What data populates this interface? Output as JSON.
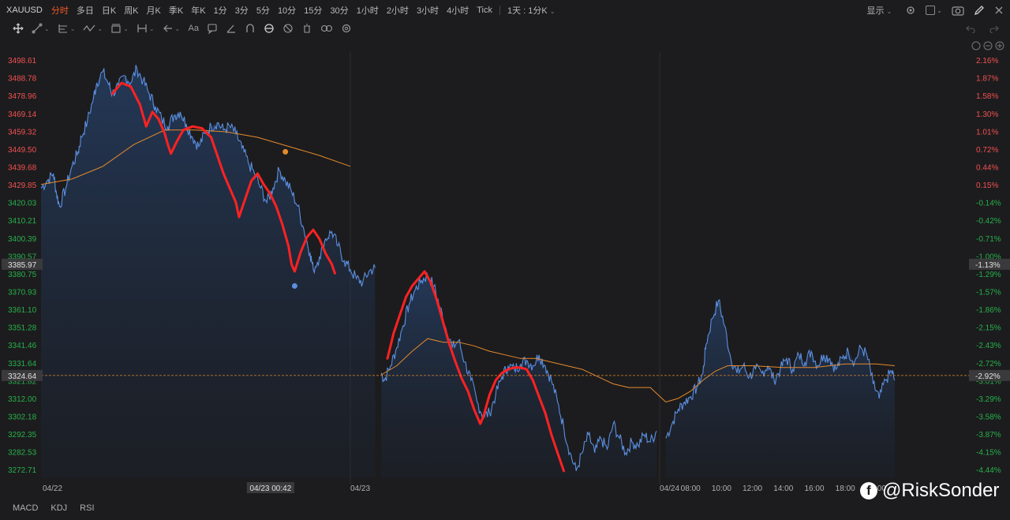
{
  "header": {
    "symbol": "XAUUSD",
    "timeframes": [
      {
        "label": "分时",
        "active": true
      },
      {
        "label": "多日",
        "active": false
      },
      {
        "label": "日K",
        "active": false
      },
      {
        "label": "周K",
        "active": false
      },
      {
        "label": "月K",
        "active": false
      },
      {
        "label": "季K",
        "active": false
      },
      {
        "label": "年K",
        "active": false
      },
      {
        "label": "1分",
        "active": false
      },
      {
        "label": "3分",
        "active": false
      },
      {
        "label": "5分",
        "active": false
      },
      {
        "label": "10分",
        "active": false
      },
      {
        "label": "15分",
        "active": false
      },
      {
        "label": "30分",
        "active": false
      },
      {
        "label": "1小时",
        "active": false
      },
      {
        "label": "2小时",
        "active": false
      },
      {
        "label": "3小时",
        "active": false
      },
      {
        "label": "4小时",
        "active": false
      },
      {
        "label": "Tick",
        "active": false
      }
    ],
    "period_select": "1天 : 1分K",
    "display_label": "显示"
  },
  "toolbar": {
    "tools": [
      "crosshair-icon",
      "line-tool-icon",
      "fib-tool-icon",
      "pattern-tool-icon",
      "shape-tool-icon",
      "measure-tool-icon",
      "arrow-tool-icon",
      "text-tool-icon",
      "note-tool-icon",
      "pen-tool-icon",
      "magnet-icon",
      "lock-icon",
      "hide-icon",
      "trash-icon",
      "link-icon",
      "settings-icon"
    ],
    "text_tool_label": "Aa"
  },
  "indicators": [
    "MACD",
    "KDJ",
    "RSI"
  ],
  "watermark": "@RiskSonder",
  "colors": {
    "price_line": "#5b8fe0",
    "ma_line": "#e58a2c",
    "annotation": "#ff2222",
    "up_label": "#f25050",
    "down_label": "#27b04a",
    "current_line": "#e58a2c"
  },
  "chart_data": {
    "type": "line",
    "symbol": "XAUUSD",
    "ylim": [
      3268,
      3503
    ],
    "prev_close": 3424.36,
    "price_ticks": [
      {
        "v": 3498.61,
        "pct": "2.16%"
      },
      {
        "v": 3488.78,
        "pct": "1.87%"
      },
      {
        "v": 3478.96,
        "pct": "1.58%"
      },
      {
        "v": 3469.14,
        "pct": "1.30%"
      },
      {
        "v": 3459.32,
        "pct": "1.01%"
      },
      {
        "v": 3449.5,
        "pct": "0.72%"
      },
      {
        "v": 3439.68,
        "pct": "0.44%"
      },
      {
        "v": 3429.85,
        "pct": "0.15%"
      },
      {
        "v": 3420.03,
        "pct": "-0.14%"
      },
      {
        "v": 3410.21,
        "pct": "-0.42%"
      },
      {
        "v": 3400.39,
        "pct": "-0.71%"
      },
      {
        "v": 3390.57,
        "pct": "-1.00%"
      },
      {
        "v": 3380.75,
        "pct": "-1.29%"
      },
      {
        "v": 3370.93,
        "pct": "-1.57%"
      },
      {
        "v": 3361.1,
        "pct": "-1.86%"
      },
      {
        "v": 3351.28,
        "pct": "-2.15%"
      },
      {
        "v": 3341.46,
        "pct": "-2.43%"
      },
      {
        "v": 3331.64,
        "pct": "-2.72%"
      },
      {
        "v": 3321.82,
        "pct": "-3.01%"
      },
      {
        "v": 3312.0,
        "pct": "-3.29%"
      },
      {
        "v": 3302.18,
        "pct": "-3.58%"
      },
      {
        "v": 3292.35,
        "pct": "-3.87%"
      },
      {
        "v": 3282.53,
        "pct": "-4.15%"
      },
      {
        "v": 3272.71,
        "pct": "-4.44%"
      }
    ],
    "crosshair": {
      "price": "3385.97",
      "pct": "-1.13%",
      "value": 3385.97
    },
    "current": {
      "price": "3324.64",
      "pct": "-2.92%",
      "value": 3324.64
    },
    "time_labels": [
      {
        "t": 0.0,
        "label": "04/22"
      },
      {
        "t": 0.742,
        "label": "04/23 00:42"
      },
      {
        "t": 1.0,
        "label": "04/23"
      },
      {
        "t": 2.0,
        "label": "04/24"
      },
      {
        "t": 2.1,
        "label": "08:00"
      },
      {
        "t": 2.2,
        "label": "10:00"
      },
      {
        "t": 2.3,
        "label": "12:00"
      },
      {
        "t": 2.4,
        "label": "14:00"
      },
      {
        "t": 2.5,
        "label": "16:00"
      },
      {
        "t": 2.6,
        "label": "18:00"
      },
      {
        "t": 2.7,
        "label": "20:00"
      }
    ],
    "day_breaks": [
      1.0,
      2.0
    ],
    "price_series": [
      [
        0.0,
        3428
      ],
      [
        0.02,
        3432
      ],
      [
        0.04,
        3436
      ],
      [
        0.05,
        3425
      ],
      [
        0.06,
        3418
      ],
      [
        0.08,
        3428
      ],
      [
        0.1,
        3440
      ],
      [
        0.12,
        3448
      ],
      [
        0.13,
        3456
      ],
      [
        0.15,
        3465
      ],
      [
        0.17,
        3478
      ],
      [
        0.18,
        3486
      ],
      [
        0.2,
        3492
      ],
      [
        0.22,
        3485
      ],
      [
        0.23,
        3480
      ],
      [
        0.25,
        3484
      ],
      [
        0.27,
        3490
      ],
      [
        0.29,
        3486
      ],
      [
        0.31,
        3494
      ],
      [
        0.33,
        3487
      ],
      [
        0.35,
        3480
      ],
      [
        0.37,
        3473
      ],
      [
        0.39,
        3466
      ],
      [
        0.41,
        3462
      ],
      [
        0.43,
        3468
      ],
      [
        0.45,
        3470
      ],
      [
        0.47,
        3463
      ],
      [
        0.49,
        3456
      ],
      [
        0.51,
        3451
      ],
      [
        0.53,
        3458
      ],
      [
        0.55,
        3462
      ],
      [
        0.57,
        3464
      ],
      [
        0.59,
        3460
      ],
      [
        0.61,
        3462
      ],
      [
        0.63,
        3458
      ],
      [
        0.65,
        3450
      ],
      [
        0.67,
        3442
      ],
      [
        0.69,
        3436
      ],
      [
        0.71,
        3428
      ],
      [
        0.73,
        3420
      ],
      [
        0.75,
        3428
      ],
      [
        0.77,
        3438
      ],
      [
        0.79,
        3432
      ],
      [
        0.81,
        3426
      ],
      [
        0.83,
        3418
      ],
      [
        0.85,
        3405
      ],
      [
        0.87,
        3392
      ],
      [
        0.88,
        3383
      ],
      [
        0.9,
        3390
      ],
      [
        0.92,
        3400
      ],
      [
        0.94,
        3404
      ],
      [
        0.96,
        3396
      ],
      [
        0.98,
        3388
      ],
      [
        1.0,
        3383
      ],
      [
        1.02,
        3378
      ],
      [
        1.04,
        3376
      ],
      [
        1.06,
        3382
      ],
      [
        1.08,
        3384
      ],
      [
        1.1,
        3326
      ],
      [
        1.11,
        3322
      ],
      [
        1.13,
        3330
      ],
      [
        1.15,
        3340
      ],
      [
        1.17,
        3352
      ],
      [
        1.19,
        3364
      ],
      [
        1.21,
        3372
      ],
      [
        1.23,
        3377
      ],
      [
        1.25,
        3380
      ],
      [
        1.27,
        3374
      ],
      [
        1.29,
        3362
      ],
      [
        1.31,
        3350
      ],
      [
        1.33,
        3340
      ],
      [
        1.35,
        3344
      ],
      [
        1.37,
        3332
      ],
      [
        1.39,
        3322
      ],
      [
        1.41,
        3310
      ],
      [
        1.43,
        3302
      ],
      [
        1.45,
        3304
      ],
      [
        1.47,
        3314
      ],
      [
        1.49,
        3324
      ],
      [
        1.51,
        3330
      ],
      [
        1.53,
        3328
      ],
      [
        1.55,
        3331
      ],
      [
        1.57,
        3333
      ],
      [
        1.59,
        3330
      ],
      [
        1.61,
        3336
      ],
      [
        1.63,
        3330
      ],
      [
        1.65,
        3322
      ],
      [
        1.67,
        3310
      ],
      [
        1.69,
        3296
      ],
      [
        1.71,
        3282
      ],
      [
        1.73,
        3272
      ],
      [
        1.75,
        3282
      ],
      [
        1.77,
        3292
      ],
      [
        1.79,
        3282
      ],
      [
        1.81,
        3290
      ],
      [
        1.83,
        3284
      ],
      [
        1.85,
        3298
      ],
      [
        1.87,
        3290
      ],
      [
        1.89,
        3282
      ],
      [
        1.91,
        3288
      ],
      [
        1.93,
        3286
      ],
      [
        1.95,
        3292
      ],
      [
        1.97,
        3288
      ],
      [
        1.99,
        3294
      ],
      [
        2.02,
        3290
      ],
      [
        2.04,
        3298
      ],
      [
        2.06,
        3306
      ],
      [
        2.08,
        3310
      ],
      [
        2.1,
        3313
      ],
      [
        2.12,
        3318
      ],
      [
        2.14,
        3326
      ],
      [
        2.15,
        3342
      ],
      [
        2.17,
        3356
      ],
      [
        2.19,
        3366
      ],
      [
        2.21,
        3352
      ],
      [
        2.23,
        3334
      ],
      [
        2.25,
        3326
      ],
      [
        2.27,
        3330
      ],
      [
        2.29,
        3324
      ],
      [
        2.31,
        3328
      ],
      [
        2.33,
        3326
      ],
      [
        2.35,
        3330
      ],
      [
        2.37,
        3322
      ],
      [
        2.39,
        3328
      ],
      [
        2.41,
        3334
      ],
      [
        2.43,
        3328
      ],
      [
        2.45,
        3336
      ],
      [
        2.47,
        3332
      ],
      [
        2.49,
        3338
      ],
      [
        2.51,
        3330
      ],
      [
        2.53,
        3336
      ],
      [
        2.55,
        3334
      ],
      [
        2.57,
        3328
      ],
      [
        2.59,
        3334
      ],
      [
        2.61,
        3338
      ],
      [
        2.63,
        3332
      ],
      [
        2.65,
        3340
      ],
      [
        2.67,
        3336
      ],
      [
        2.69,
        3320
      ],
      [
        2.71,
        3312
      ],
      [
        2.73,
        3322
      ],
      [
        2.75,
        3327
      ],
      [
        2.76,
        3322
      ]
    ],
    "ma_series": [
      [
        0.0,
        3430
      ],
      [
        0.1,
        3433
      ],
      [
        0.2,
        3440
      ],
      [
        0.3,
        3452
      ],
      [
        0.4,
        3460
      ],
      [
        0.5,
        3460
      ],
      [
        0.6,
        3459
      ],
      [
        0.7,
        3456
      ],
      [
        0.8,
        3451
      ],
      [
        0.9,
        3446
      ],
      [
        1.0,
        3440
      ],
      [
        1.1,
        3325
      ],
      [
        1.15,
        3330
      ],
      [
        1.2,
        3338
      ],
      [
        1.25,
        3345
      ],
      [
        1.3,
        3343
      ],
      [
        1.35,
        3343
      ],
      [
        1.4,
        3341
      ],
      [
        1.45,
        3338
      ],
      [
        1.5,
        3336
      ],
      [
        1.55,
        3334
      ],
      [
        1.6,
        3334
      ],
      [
        1.65,
        3332
      ],
      [
        1.7,
        3330
      ],
      [
        1.75,
        3328
      ],
      [
        1.8,
        3324
      ],
      [
        1.85,
        3320
      ],
      [
        1.9,
        3318
      ],
      [
        1.97,
        3318
      ],
      [
        2.02,
        3310
      ],
      [
        2.06,
        3312
      ],
      [
        2.1,
        3316
      ],
      [
        2.14,
        3322
      ],
      [
        2.18,
        3327
      ],
      [
        2.22,
        3330
      ],
      [
        2.3,
        3330
      ],
      [
        2.4,
        3329
      ],
      [
        2.5,
        3329
      ],
      [
        2.6,
        3331
      ],
      [
        2.7,
        3331
      ],
      [
        2.76,
        3330
      ]
    ],
    "annotation_path": [
      [
        0.23,
        3480
      ],
      [
        0.26,
        3486
      ],
      [
        0.29,
        3484
      ],
      [
        0.32,
        3474
      ],
      [
        0.34,
        3462
      ],
      [
        0.36,
        3470
      ],
      [
        0.38,
        3466
      ],
      [
        0.4,
        3458
      ],
      [
        0.41,
        3452
      ],
      [
        0.42,
        3447
      ],
      [
        0.44,
        3454
      ],
      [
        0.46,
        3460
      ],
      [
        0.49,
        3462
      ],
      [
        0.52,
        3461
      ],
      [
        0.55,
        3456
      ],
      [
        0.57,
        3446
      ],
      [
        0.59,
        3436
      ],
      [
        0.61,
        3428
      ],
      [
        0.63,
        3420
      ],
      [
        0.64,
        3412
      ],
      [
        0.66,
        3422
      ],
      [
        0.68,
        3432
      ],
      [
        0.7,
        3436
      ],
      [
        0.72,
        3430
      ],
      [
        0.74,
        3425
      ],
      [
        0.76,
        3418
      ],
      [
        0.78,
        3408
      ],
      [
        0.8,
        3396
      ],
      [
        0.81,
        3386
      ],
      [
        0.82,
        3382
      ],
      [
        0.84,
        3393
      ],
      [
        0.86,
        3401
      ],
      [
        0.88,
        3405
      ],
      [
        0.9,
        3400
      ],
      [
        0.92,
        3392
      ],
      [
        0.94,
        3386
      ],
      [
        0.95,
        3381
      ]
    ],
    "annotation_path_2": [
      [
        1.12,
        3334
      ],
      [
        1.14,
        3348
      ],
      [
        1.16,
        3358
      ],
      [
        1.18,
        3368
      ],
      [
        1.2,
        3374
      ],
      [
        1.22,
        3378
      ],
      [
        1.24,
        3382
      ],
      [
        1.26,
        3376
      ],
      [
        1.28,
        3366
      ],
      [
        1.3,
        3354
      ],
      [
        1.32,
        3342
      ],
      [
        1.34,
        3332
      ],
      [
        1.36,
        3323
      ],
      [
        1.38,
        3316
      ],
      [
        1.4,
        3306
      ],
      [
        1.42,
        3298
      ],
      [
        1.43,
        3302
      ],
      [
        1.45,
        3314
      ],
      [
        1.47,
        3322
      ],
      [
        1.49,
        3326
      ],
      [
        1.51,
        3328
      ],
      [
        1.53,
        3329
      ],
      [
        1.55,
        3329
      ],
      [
        1.57,
        3328
      ],
      [
        1.59,
        3322
      ],
      [
        1.61,
        3313
      ],
      [
        1.63,
        3304
      ],
      [
        1.65,
        3292
      ],
      [
        1.67,
        3282
      ],
      [
        1.69,
        3272
      ]
    ],
    "markers": [
      {
        "t": 0.79,
        "v": 3448,
        "color": "#e58a2c"
      },
      {
        "t": 0.82,
        "v": 3374,
        "color": "#5b8fe0"
      }
    ]
  }
}
